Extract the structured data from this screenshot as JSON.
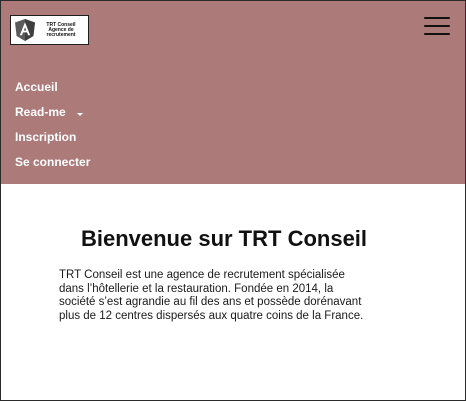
{
  "header": {
    "bg_color": "#ad7a7a",
    "logo": {
      "icon": "angular-shield-icon",
      "line1": "TRT Conseil",
      "line2": "Agence de",
      "line3": "recrutement"
    },
    "menu_icon": "hamburger-menu-icon"
  },
  "nav": {
    "items": [
      {
        "label": "Accueil"
      },
      {
        "label": "Read-me",
        "dropdown": true
      },
      {
        "label": "Inscription"
      },
      {
        "label": "Se connecter"
      }
    ]
  },
  "main": {
    "title": "Bienvenue sur TRT Conseil",
    "intro_lines": [
      "TRT Conseil est une agence de recrutement spécialisée",
      "dans l’hôtellerie et la restauration. Fondée en  2014, la",
      "société s’est agrandie au fil des ans et possède dorénavant",
      "plus de 12 centres dispersés aux  quatre coins de la France."
    ]
  }
}
